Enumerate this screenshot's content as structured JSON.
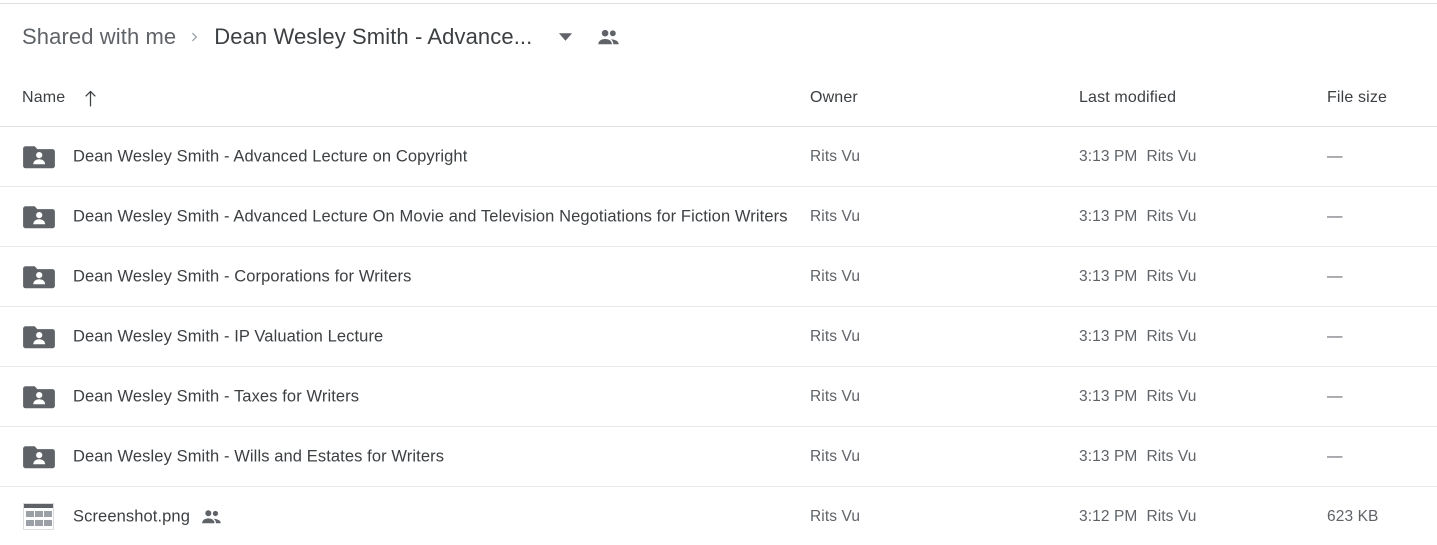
{
  "breadcrumb": {
    "parent_label": "Shared with me",
    "separator_icon": "chevron-right-icon",
    "current_label": "Dean Wesley Smith - Advance...",
    "caret_icon": "caret-down-icon",
    "people_icon": "people-shared-icon"
  },
  "columns": {
    "name": "Name",
    "sort_icon": "arrow-up-icon",
    "owner": "Owner",
    "last_modified": "Last modified",
    "file_size": "File size"
  },
  "colors": {
    "text_primary": "#3c4043",
    "text_secondary": "#5f6368",
    "icon_gray": "#5f6368",
    "divider": "#e8e8e8",
    "background": "#ffffff"
  },
  "rows": [
    {
      "icon": "shared-folder-icon",
      "name": "Dean Wesley Smith - Advanced Lecture on Copyright",
      "shared_badge": false,
      "owner": "Rits Vu",
      "modified_time": "3:13 PM",
      "modified_by": "Rits Vu",
      "size": "—"
    },
    {
      "icon": "shared-folder-icon",
      "name": "Dean Wesley Smith - Advanced Lecture On Movie and Television Negotiations for Fiction Writers",
      "shared_badge": false,
      "owner": "Rits Vu",
      "modified_time": "3:13 PM",
      "modified_by": "Rits Vu",
      "size": "—"
    },
    {
      "icon": "shared-folder-icon",
      "name": "Dean Wesley Smith - Corporations for Writers",
      "shared_badge": false,
      "owner": "Rits Vu",
      "modified_time": "3:13 PM",
      "modified_by": "Rits Vu",
      "size": "—"
    },
    {
      "icon": "shared-folder-icon",
      "name": "Dean Wesley Smith - IP Valuation Lecture",
      "shared_badge": false,
      "owner": "Rits Vu",
      "modified_time": "3:13 PM",
      "modified_by": "Rits Vu",
      "size": "—"
    },
    {
      "icon": "shared-folder-icon",
      "name": "Dean Wesley Smith - Taxes for Writers",
      "shared_badge": false,
      "owner": "Rits Vu",
      "modified_time": "3:13 PM",
      "modified_by": "Rits Vu",
      "size": "—"
    },
    {
      "icon": "shared-folder-icon",
      "name": "Dean Wesley Smith - Wills and Estates for Writers",
      "shared_badge": false,
      "owner": "Rits Vu",
      "modified_time": "3:13 PM",
      "modified_by": "Rits Vu",
      "size": "—"
    },
    {
      "icon": "image-thumbnail-icon",
      "name": "Screenshot.png",
      "shared_badge": true,
      "owner": "Rits Vu",
      "modified_time": "3:12 PM",
      "modified_by": "Rits Vu",
      "size": "623 KB"
    }
  ]
}
